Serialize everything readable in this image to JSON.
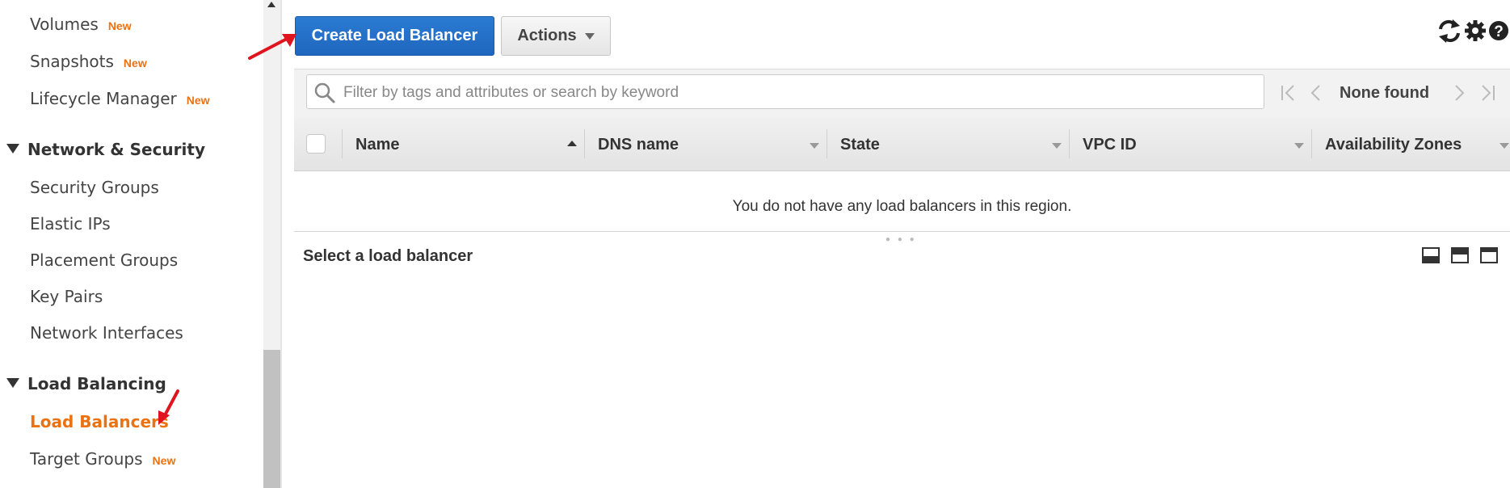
{
  "sidebar": {
    "items": [
      {
        "label": "Volumes",
        "badge": "New"
      },
      {
        "label": "Snapshots",
        "badge": "New"
      },
      {
        "label": "Lifecycle Manager",
        "badge": "New"
      },
      {
        "label": "Security Groups"
      },
      {
        "label": "Elastic IPs"
      },
      {
        "label": "Placement Groups"
      },
      {
        "label": "Key Pairs"
      },
      {
        "label": "Network Interfaces"
      },
      {
        "label": "Load Balancers",
        "active": true
      },
      {
        "label": "Target Groups",
        "badge": "New"
      }
    ],
    "sections": {
      "network_security": "Network & Security",
      "load_balancing": "Load Balancing"
    }
  },
  "toolbar": {
    "create_label": "Create Load Balancer",
    "actions_label": "Actions",
    "icons": [
      "refresh-icon",
      "gear-icon",
      "help-icon"
    ]
  },
  "filter": {
    "placeholder": "Filter by tags and attributes or search by keyword",
    "pager_text": "None found"
  },
  "table": {
    "columns": [
      "Name",
      "DNS name",
      "State",
      "VPC ID",
      "Availability Zones"
    ],
    "sorted_column": "Name",
    "empty_message": "You do not have any load balancers in this region."
  },
  "details": {
    "title": "Select a load balancer"
  },
  "colors": {
    "accent": "#ec7211",
    "primary_button": "#1f66be",
    "annotation_arrow": "#e0141e"
  }
}
